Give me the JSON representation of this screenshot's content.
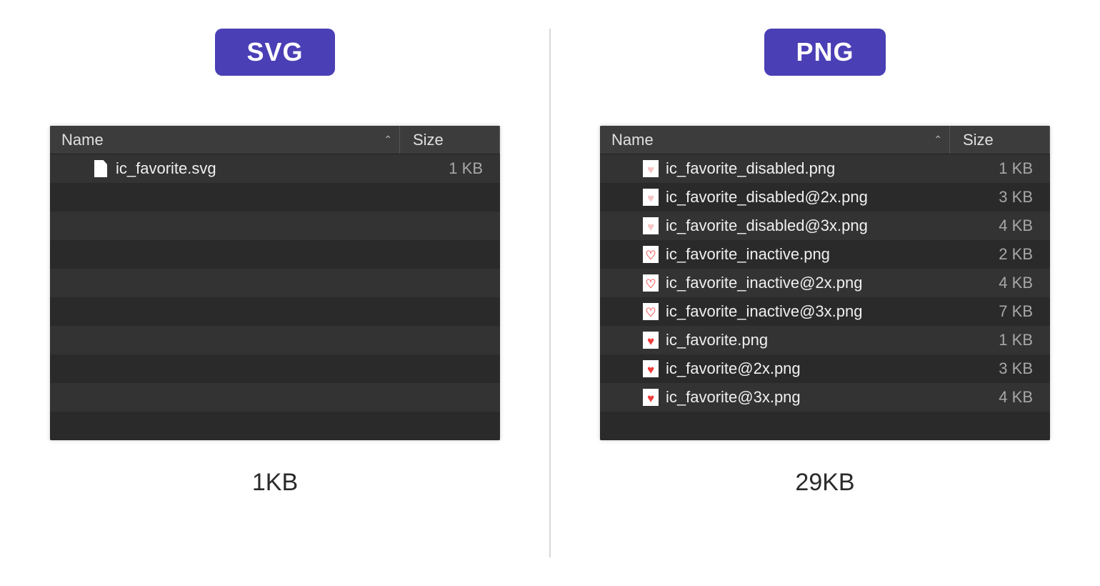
{
  "left": {
    "badge": "SVG",
    "columns": {
      "name": "Name",
      "size": "Size"
    },
    "files": [
      {
        "name": "ic_favorite.svg",
        "size": "1 KB",
        "icon": "doc"
      }
    ],
    "empty_rows": 9,
    "total": "1KB"
  },
  "right": {
    "badge": "PNG",
    "columns": {
      "name": "Name",
      "size": "Size"
    },
    "files": [
      {
        "name": "ic_favorite_disabled.png",
        "size": "1 KB",
        "icon": "heart-disabled"
      },
      {
        "name": "ic_favorite_disabled@2x.png",
        "size": "3 KB",
        "icon": "heart-disabled"
      },
      {
        "name": "ic_favorite_disabled@3x.png",
        "size": "4 KB",
        "icon": "heart-disabled"
      },
      {
        "name": "ic_favorite_inactive.png",
        "size": "2 KB",
        "icon": "heart-inactive"
      },
      {
        "name": "ic_favorite_inactive@2x.png",
        "size": "4 KB",
        "icon": "heart-inactive"
      },
      {
        "name": "ic_favorite_inactive@3x.png",
        "size": "7 KB",
        "icon": "heart-inactive"
      },
      {
        "name": "ic_favorite.png",
        "size": "1 KB",
        "icon": "heart-active"
      },
      {
        "name": "ic_favorite@2x.png",
        "size": "3 KB",
        "icon": "heart-active"
      },
      {
        "name": "ic_favorite@3x.png",
        "size": "4 KB",
        "icon": "heart-active"
      }
    ],
    "empty_rows": 1,
    "total": "29KB"
  }
}
